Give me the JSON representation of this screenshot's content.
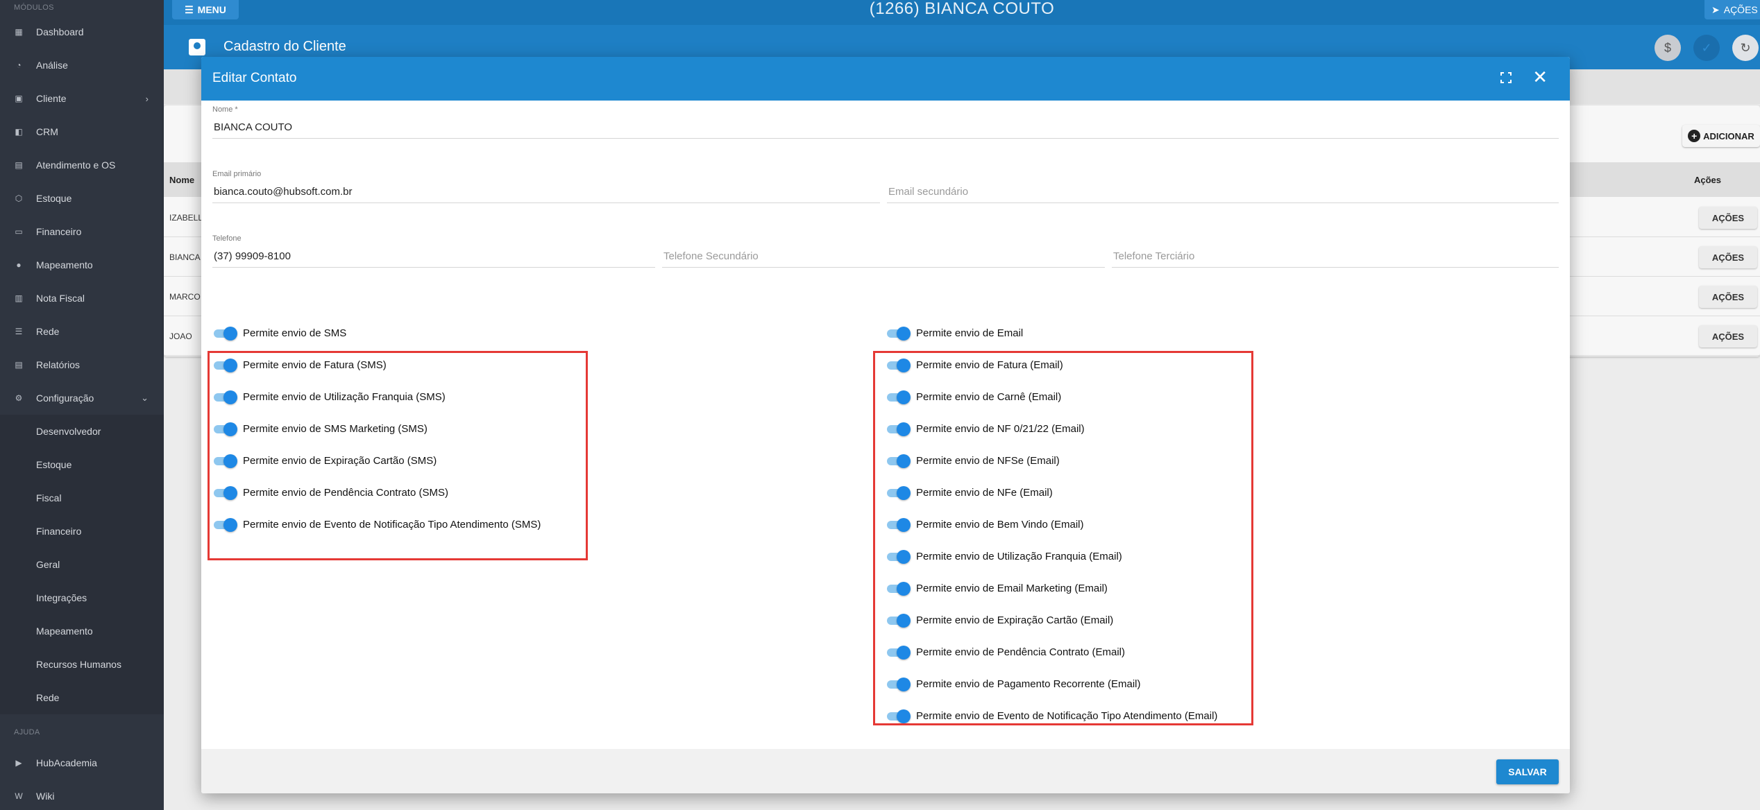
{
  "sidebar": {
    "section_label": "MÓDULOS",
    "items": [
      {
        "label": "Dashboard",
        "icon": "dashboard-icon",
        "glyph": "▦"
      },
      {
        "label": "Análise",
        "icon": "chart-pie-icon",
        "glyph": "◔"
      },
      {
        "label": "Cliente",
        "icon": "client-card-icon",
        "glyph": "▣",
        "chevron": "›"
      },
      {
        "label": "CRM",
        "icon": "crm-board-icon",
        "glyph": "◧"
      },
      {
        "label": "Atendimento e OS",
        "icon": "calendar-icon",
        "glyph": "▤"
      },
      {
        "label": "Estoque",
        "icon": "box-icon",
        "glyph": "⬡"
      },
      {
        "label": "Financeiro",
        "icon": "money-icon",
        "glyph": "▭"
      },
      {
        "label": "Mapeamento",
        "icon": "map-pin-icon",
        "glyph": "●"
      },
      {
        "label": "Nota Fiscal",
        "icon": "receipt-icon",
        "glyph": "▥"
      },
      {
        "label": "Rede",
        "icon": "network-icon",
        "glyph": "☰"
      },
      {
        "label": "Relatórios",
        "icon": "report-icon",
        "glyph": "▤"
      },
      {
        "label": "Configuração",
        "icon": "gear-icon",
        "glyph": "⚙",
        "chevron": "⌄"
      }
    ],
    "sub_items": [
      "Desenvolvedor",
      "Estoque",
      "Fiscal",
      "Financeiro",
      "Geral",
      "Integrações",
      "Mapeamento",
      "Recursos Humanos",
      "Rede"
    ],
    "help_label": "AJUDA",
    "help_items": [
      {
        "label": "HubAcademia",
        "icon": "youtube-icon",
        "glyph": "▶"
      },
      {
        "label": "Wiki",
        "icon": "wikipedia-icon",
        "glyph": "W"
      }
    ]
  },
  "topbar": {
    "menu_label": "MENU",
    "title": "(1266) BIANCA COUTO",
    "acoes_label": "AÇÕES"
  },
  "subheader": {
    "title": "Cadastro do Cliente",
    "dollar_glyph": "$",
    "check_glyph": "✓",
    "refresh_glyph": "↻"
  },
  "background": {
    "adicionar_label": "ADICIONAR",
    "col_nome": "Nome",
    "col_acoes": "Ações",
    "rows": [
      {
        "nome": "IZABELL",
        "acoes": "AÇÕES"
      },
      {
        "nome": "BIANCA",
        "acoes": "AÇÕES"
      },
      {
        "nome": "MARCO",
        "acoes": "AÇÕES"
      },
      {
        "nome": "JOAO",
        "acoes": "AÇÕES"
      }
    ]
  },
  "dialog": {
    "title": "Editar Contato",
    "close_glyph": "✕",
    "nome_label": "Nome *",
    "nome_value": "BIANCA COUTO",
    "email_primario_label": "Email primário",
    "email_primario_value": "bianca.couto@hubsoft.com.br",
    "email_secundario_placeholder": "Email secundário",
    "telefone_label": "Telefone",
    "telefone_value": "(37) 99909-8100",
    "telefone_secundario_placeholder": "Telefone Secundário",
    "telefone_terciario_placeholder": "Telefone Terciário",
    "sms_toggles": [
      "Permite envio de SMS",
      "Permite envio de Fatura (SMS)",
      "Permite envio de Utilização Franquia (SMS)",
      "Permite envio de SMS Marketing (SMS)",
      "Permite envio de Expiração Cartão (SMS)",
      "Permite envio de Pendência Contrato (SMS)",
      "Permite envio de Evento de Notificação Tipo Atendimento (SMS)"
    ],
    "email_toggles": [
      "Permite envio de Email",
      "Permite envio de Fatura (Email)",
      "Permite envio de Carnê (Email)",
      "Permite envio de NF 0/21/22 (Email)",
      "Permite envio de NFSe (Email)",
      "Permite envio de NFe (Email)",
      "Permite envio de Bem Vindo (Email)",
      "Permite envio de Utilização Franquia (Email)",
      "Permite envio de Email Marketing (Email)",
      "Permite envio de Expiração Cartão (Email)",
      "Permite envio de Pendência Contrato (Email)",
      "Permite envio de Pagamento Recorrente (Email)",
      "Permite envio de Evento de Notificação Tipo Atendimento (Email)"
    ],
    "salvar_label": "SALVAR"
  },
  "colors": {
    "primary": "#1e88d0",
    "sidebar": "#2f3540",
    "highlight": "#e53935",
    "toggle_on": "#1e88e5"
  }
}
